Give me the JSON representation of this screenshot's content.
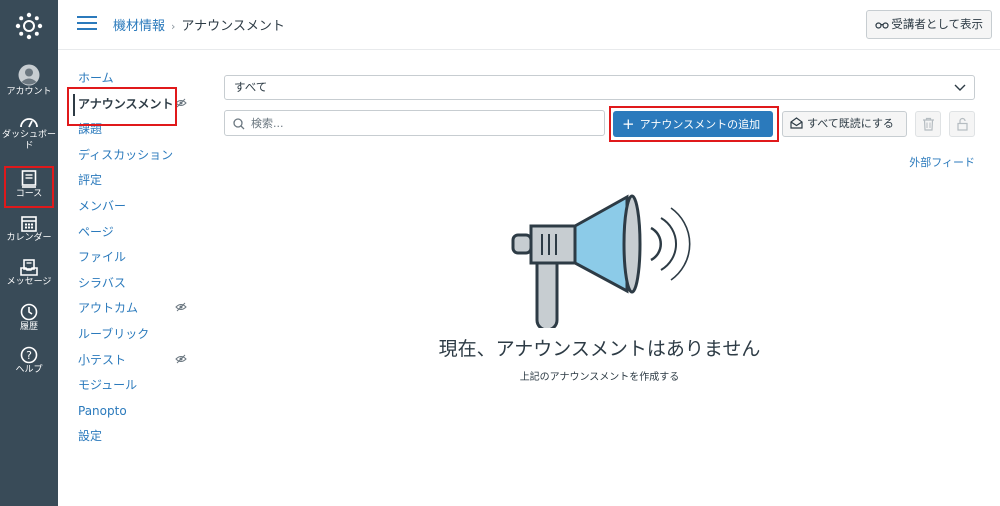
{
  "global_nav": {
    "items": [
      {
        "label": "",
        "icon": "canvas-logo-icon"
      },
      {
        "label": "アカウント",
        "icon": "account-icon"
      },
      {
        "label": "ダッシュボード",
        "icon": "dashboard-icon"
      },
      {
        "label": "コース",
        "icon": "courses-icon"
      },
      {
        "label": "カレンダー",
        "icon": "calendar-icon"
      },
      {
        "label": "メッセージ",
        "icon": "inbox-icon"
      },
      {
        "label": "履歴",
        "icon": "history-icon"
      },
      {
        "label": "ヘルプ",
        "icon": "help-icon"
      }
    ],
    "dashboard_line1": "ダッシュボー",
    "dashboard_line2": "ド"
  },
  "header": {
    "breadcrumb_course": "機材情報",
    "breadcrumb_separator": "›",
    "breadcrumb_page": "アナウンスメント",
    "student_view_label": "受講者として表示"
  },
  "course_nav": {
    "items": [
      {
        "label": "ホーム"
      },
      {
        "label": "アナウンスメント"
      },
      {
        "label": "課題"
      },
      {
        "label": "ディスカッション"
      },
      {
        "label": "評定"
      },
      {
        "label": "メンバー"
      },
      {
        "label": "ページ"
      },
      {
        "label": "ファイル"
      },
      {
        "label": "シラバス"
      },
      {
        "label": "アウトカム"
      },
      {
        "label": "ルーブリック"
      },
      {
        "label": "小テスト"
      },
      {
        "label": "モジュール"
      },
      {
        "label": "Panopto"
      },
      {
        "label": "設定"
      }
    ]
  },
  "toolbar": {
    "filter_value": "すべて",
    "search_placeholder": "検索...",
    "add_button": "アナウンスメントの追加",
    "mark_all_read": "すべて既読にする",
    "external_feed": "外部フィード"
  },
  "empty_state": {
    "title": "現在、アナウンスメントはありません",
    "subtitle": "上記のアナウンスメントを作成する"
  },
  "colors": {
    "nav_bg": "#394b58",
    "brand_blue": "#2b7abc",
    "highlight_red": "#e0191b",
    "megaphone_blue": "#8ccbe8"
  }
}
